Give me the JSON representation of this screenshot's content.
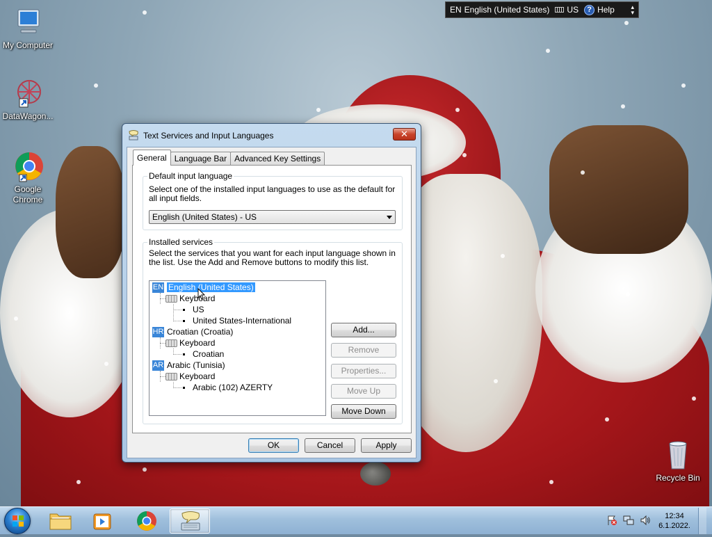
{
  "language_bar": {
    "language_code": "EN",
    "language_name": "English (United States)",
    "keyboard_label": "US",
    "help_label": "Help"
  },
  "desktop": {
    "icons": [
      {
        "label": "My Computer"
      },
      {
        "label": "DataWagon..."
      },
      {
        "label": "Google Chrome"
      },
      {
        "label": "Recycle Bin"
      }
    ]
  },
  "dialog": {
    "title": "Text Services and Input Languages",
    "close_label": "✕",
    "tabs": [
      {
        "label": "General"
      },
      {
        "label": "Language Bar"
      },
      {
        "label": "Advanced Key Settings"
      }
    ],
    "default_input": {
      "title": "Default input language",
      "description": "Select one of the installed input languages to use as the default for all input fields.",
      "selected_value": "English (United States) - US"
    },
    "installed_services": {
      "title": "Installed services",
      "description": "Select the services that you want for each input language shown in the list. Use the Add and Remove buttons to modify this list.",
      "languages": [
        {
          "code": "EN",
          "name": "English (United States)",
          "category": "Keyboard",
          "layouts": [
            "US",
            "United States-International"
          ]
        },
        {
          "code": "HR",
          "name": "Croatian (Croatia)",
          "category": "Keyboard",
          "layouts": [
            "Croatian"
          ]
        },
        {
          "code": "AR",
          "name": "Arabic (Tunisia)",
          "category": "Keyboard",
          "layouts": [
            "Arabic (102) AZERTY"
          ]
        }
      ],
      "buttons": {
        "add": "Add...",
        "remove": "Remove",
        "properties": "Properties...",
        "move_up": "Move Up",
        "move_down": "Move Down"
      }
    },
    "footer": {
      "ok": "OK",
      "cancel": "Cancel",
      "apply": "Apply"
    }
  },
  "taskbar": {
    "clock_time": "12:34",
    "clock_date": "6.1.2022."
  }
}
